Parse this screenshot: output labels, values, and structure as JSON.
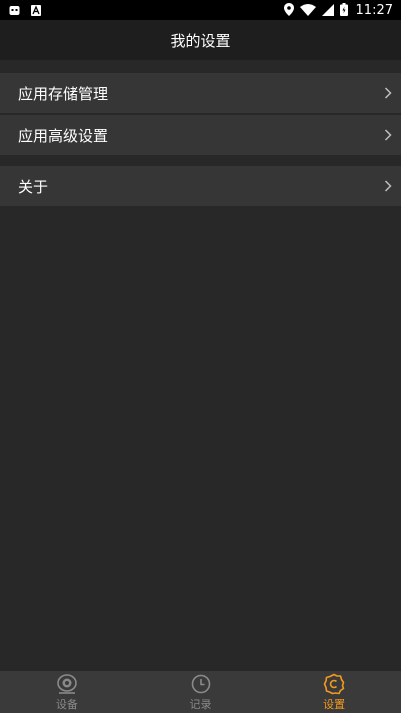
{
  "status_bar": {
    "time": "11:27",
    "left_icons": [
      "notification-icon",
      "a-app-icon"
    ],
    "right_icons": [
      "location-icon",
      "wifi-icon",
      "signal-icon",
      "battery-icon"
    ]
  },
  "header": {
    "title": "我的设置"
  },
  "menu": {
    "storage": "应用存储管理",
    "advanced": "应用高级设置",
    "about": "关于"
  },
  "bottom_nav": {
    "tabs": [
      {
        "label": "设备",
        "icon": "camera-icon",
        "active": false
      },
      {
        "label": "记录",
        "icon": "clock-icon",
        "active": false
      },
      {
        "label": "设置",
        "icon": "gear-icon",
        "active": true
      }
    ]
  },
  "colors": {
    "background": "#282828",
    "row": "#363636",
    "header": "#1e1e1e",
    "nav": "#3a3a3a",
    "accent": "#f39a1e",
    "inactive": "#8a8a8a"
  }
}
